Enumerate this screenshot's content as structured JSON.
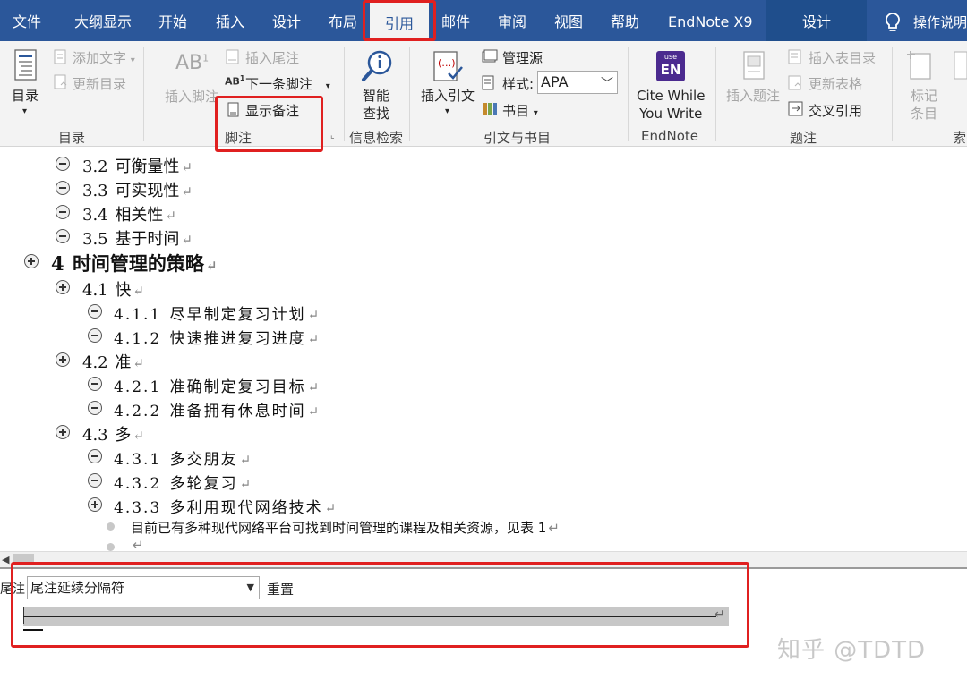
{
  "tabs": [
    {
      "label": "文件"
    },
    {
      "label": "大纲显示"
    },
    {
      "label": "开始"
    },
    {
      "label": "插入"
    },
    {
      "label": "设计"
    },
    {
      "label": "布局"
    },
    {
      "label": "引用"
    },
    {
      "label": "邮件"
    },
    {
      "label": "审阅"
    },
    {
      "label": "视图"
    },
    {
      "label": "帮助"
    },
    {
      "label": "EndNote X9"
    },
    {
      "label": "设计"
    }
  ],
  "active_tab": "引用",
  "tell_me": "操作说明",
  "ribbon": {
    "toc": {
      "button": "目录",
      "add_text": "添加文字",
      "update_toc": "更新目录",
      "group": "目录"
    },
    "footnotes": {
      "insert_footnote": "插入脚注",
      "insert_endnote": "插入尾注",
      "next_footnote": "下一条脚注",
      "show_notes": "显示备注",
      "group": "脚注",
      "ab_glyph": "AB",
      "ab_sup": "1",
      "ab_small": "AB"
    },
    "research": {
      "smart_lookup_1": "智能",
      "smart_lookup_2": "查找",
      "group": "信息检索"
    },
    "citations": {
      "insert_citation": "插入引文",
      "manage_sources": "管理源",
      "style_label": "样式:",
      "style_value": "APA",
      "bibliography": "书目",
      "group": "引文与书目"
    },
    "endnote": {
      "logo_top": "use",
      "logo_main": "EN",
      "cite_1": "Cite While",
      "cite_2": "You Write",
      "group": "EndNote"
    },
    "captions": {
      "insert_caption": "插入题注",
      "insert_tof": "插入表目录",
      "update_table": "更新表格",
      "cross_ref": "交叉引用",
      "group": "题注"
    },
    "index": {
      "mark_entry_1": "标记",
      "mark_entry_2": "条目",
      "group_partial": "索"
    }
  },
  "outline": [
    {
      "num": "3.2",
      "text": "可衡量性"
    },
    {
      "num": "3.3",
      "text": "可实现性"
    },
    {
      "num": "3.4",
      "text": "相关性"
    },
    {
      "num": "3.5",
      "text": "基于时间"
    },
    {
      "num": "4",
      "text": "时间管理的策略"
    },
    {
      "num": "4.1",
      "text": "快"
    },
    {
      "num": "4.1.1",
      "text": "尽早制定复习计划"
    },
    {
      "num": "4.1.2",
      "text": "快速推进复习进度"
    },
    {
      "num": "4.2",
      "text": "准"
    },
    {
      "num": "4.2.1",
      "text": "准确制定复习目标"
    },
    {
      "num": "4.2.2",
      "text": "准备拥有休息时间"
    },
    {
      "num": "4.3",
      "text": "多"
    },
    {
      "num": "4.3.1",
      "text": "多交朋友"
    },
    {
      "num": "4.3.2",
      "text": "多轮复习"
    },
    {
      "num": "4.3.3",
      "text": "多利用现代网络技术"
    },
    {
      "num": "",
      "text": "目前已有多种现代网络平台可找到时间管理的课程及相关资源，见表 1"
    },
    {
      "num": "",
      "text": ""
    }
  ],
  "paragraph_mark": "↵",
  "note_pane": {
    "label": "尾注",
    "dropdown_value": "尾注延续分隔符",
    "reset": "重置"
  },
  "watermark": "知乎 @TDTD",
  "colors": {
    "ribbon_blue": "#2b579a",
    "highlight_red": "#e02020"
  }
}
